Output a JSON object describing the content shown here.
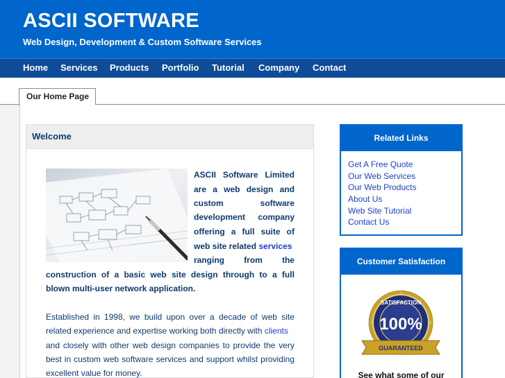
{
  "header": {
    "title": "ASCII SOFTWARE",
    "tagline": "Web Design, Development & Custom Software Services"
  },
  "nav": {
    "items": [
      "Home",
      "Services",
      "Products",
      "Portfolio",
      "Tutorial",
      "Company",
      "Contact"
    ]
  },
  "tabs": {
    "active": "Our Home Page"
  },
  "welcome": {
    "title": "Welcome",
    "intro_lines": {
      "l1": [
        "ASCII",
        "Software",
        "Limited"
      ],
      "l2": [
        "are",
        "a",
        "web",
        "design",
        "and"
      ],
      "l3": [
        "custom",
        "software"
      ],
      "l4": [
        "development",
        "company"
      ],
      "l5": [
        "offering",
        "a",
        "full",
        "suite",
        "of"
      ],
      "l6_text": "web site related ",
      "l6_link": "services",
      "l7": [
        "ranging",
        "from",
        "the"
      ],
      "l8": [
        "construction",
        "of",
        "a",
        "basic",
        "web",
        "site",
        "design",
        "through",
        "to",
        "a",
        "full"
      ],
      "l9": "blown multi-user network application."
    },
    "para2": {
      "l1": [
        "Established",
        "in",
        "1998,",
        "we",
        "build",
        "upon",
        "over",
        "a",
        "decade",
        "of",
        "web",
        "site"
      ],
      "l2_text": "related experience and expertise working both directly with ",
      "l2_link": "clients",
      "l3": [
        "and",
        "closely",
        "with",
        "other",
        "web",
        "design",
        "companies",
        "to",
        "provide",
        "the",
        "very"
      ],
      "l4": [
        "best",
        "in",
        "custom",
        "web",
        "software",
        "services",
        "and",
        "support",
        "whilst",
        "providing"
      ],
      "l5": "excellent value for money."
    }
  },
  "related_links": {
    "title": "Related Links",
    "items": [
      "Get A Free Quote",
      "Our Web Services",
      "Our Web Products",
      "About Us",
      "Web Site Tutorial",
      "Contact Us"
    ]
  },
  "satisfaction": {
    "title": "Customer Satisfaction",
    "badge_top": "SATISFACTION",
    "badge_value": "100%",
    "badge_bottom": "GUARANTEED",
    "caption": "See what some of our"
  },
  "colors": {
    "header_blue": "#0066cc",
    "nav_blue": "#0e4c98",
    "link_blue": "#1b3fd1",
    "text_navy": "#0e3a6e"
  }
}
